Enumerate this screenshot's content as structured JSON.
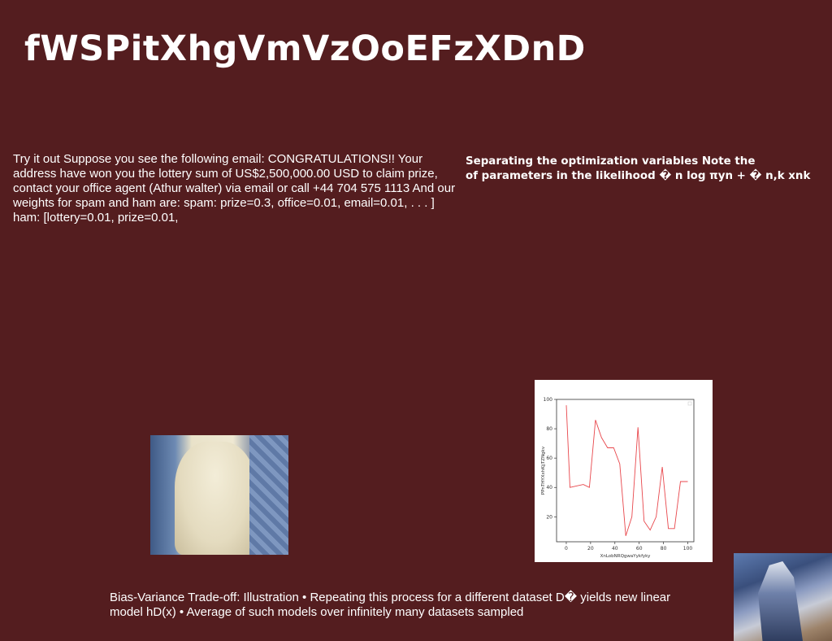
{
  "title": "fWSPitXhgVmVzOoEFzXDnD",
  "body_text": "Try it out Suppose you see the following email: CONGRATULATIONS!! Your address have won you the lottery sum of US$2,500,000.00 USD to claim prize, contact your office agent (Athur walter) via email or call +44 704 575 1113 And our weights for spam and ham are: spam: prize=0.3, office=0.01, email=0.01, . . . ] ham: [lottery=0.01, prize=0.01,",
  "side_text": {
    "line1": "Separating the optimization variables Note the",
    "line2": "of parameters in the likelihood � n log πyn + � n,k xnk"
  },
  "caption": "Bias-Variance Trade-off: Illustration • Repeating this process for a different dataset D� yields new linear model hD(x) • Average of such models over infinitely many datasets sampled",
  "colors": {
    "background": "#541d1f",
    "text": "#ffffff",
    "line": "#e8474c"
  },
  "chart_data": {
    "type": "line",
    "xlabel": "XnLobNRQgwaYykfyky",
    "ylabel": "PPnTHYXxhKjjTZNgkv",
    "xlim": [
      -8,
      105
    ],
    "ylim": [
      3,
      100
    ],
    "x_ticks": [
      0,
      20,
      40,
      60,
      80,
      100
    ],
    "y_ticks": [
      20,
      40,
      60,
      80,
      100
    ],
    "grid": false,
    "series": [
      {
        "color": "#e8474c",
        "x": [
          0,
          3,
          14,
          19,
          24,
          29,
          34,
          39,
          44,
          49,
          54,
          59,
          64,
          69,
          74,
          79,
          84,
          89,
          94,
          100
        ],
        "y": [
          96,
          40,
          42,
          40,
          86,
          74,
          67,
          67,
          56,
          7,
          20,
          81,
          17,
          11,
          20,
          54,
          12,
          12,
          44,
          44
        ]
      }
    ]
  }
}
